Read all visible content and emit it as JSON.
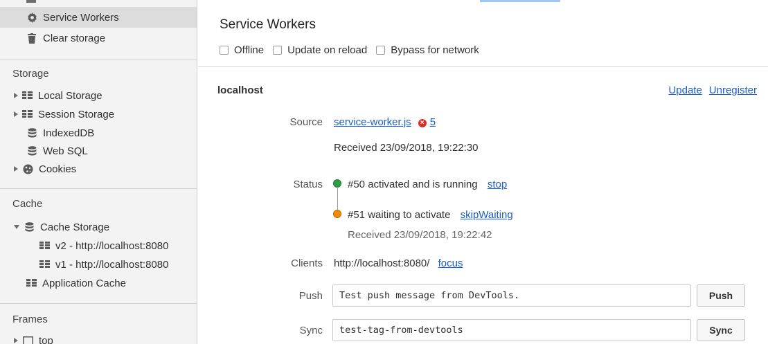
{
  "sidebar": {
    "app_items": [
      {
        "label": "Service Workers",
        "icon": "gear-icon",
        "selected": true
      },
      {
        "label": "Clear storage",
        "icon": "trash-icon",
        "selected": false
      }
    ],
    "storage": {
      "header": "Storage",
      "items": [
        {
          "label": "Local Storage",
          "icon": "table-icon",
          "expandable": true
        },
        {
          "label": "Session Storage",
          "icon": "table-icon",
          "expandable": true
        },
        {
          "label": "IndexedDB",
          "icon": "database-icon",
          "expandable": false
        },
        {
          "label": "Web SQL",
          "icon": "database-icon",
          "expandable": false
        },
        {
          "label": "Cookies",
          "icon": "cookie-icon",
          "expandable": true
        }
      ]
    },
    "cache": {
      "header": "Cache",
      "items": [
        {
          "label": "Cache Storage",
          "icon": "database-icon",
          "expanded": true
        },
        {
          "label": "v2 - http://localhost:8080",
          "icon": "table-icon"
        },
        {
          "label": "v1 - http://localhost:8080",
          "icon": "table-icon"
        },
        {
          "label": "Application Cache",
          "icon": "table-icon"
        }
      ]
    },
    "frames": {
      "header": "Frames",
      "items": [
        {
          "label": "top",
          "icon": "frame-icon",
          "expandable": true
        }
      ]
    }
  },
  "main": {
    "title": "Service Workers",
    "options": [
      {
        "label": "Offline",
        "checked": false
      },
      {
        "label": "Update on reload",
        "checked": false
      },
      {
        "label": "Bypass for network",
        "checked": false
      }
    ],
    "worker": {
      "host": "localhost",
      "update_link": "Update",
      "unregister_link": "Unregister",
      "source_label": "Source",
      "source_file": "service-worker.js",
      "error_count": "5",
      "source_received": "Received 23/09/2018, 19:22:30",
      "status_label": "Status",
      "status_active": "#50 activated and is running",
      "stop_link": "stop",
      "status_waiting": "#51 waiting to activate",
      "skip_link": "skipWaiting",
      "waiting_received": "Received 23/09/2018, 19:22:42",
      "clients_label": "Clients",
      "client_url": "http://localhost:8080/",
      "focus_link": "focus",
      "push_label": "Push",
      "push_value": "Test push message from DevTools.",
      "push_button": "Push",
      "sync_label": "Sync",
      "sync_value": "test-tag-from-devtools",
      "sync_button": "Sync"
    }
  },
  "colors": {
    "link": "#1a5ec7",
    "active_status": "#2f9e44",
    "waiting_status": "#f08c00",
    "error": "#d93025",
    "selected_row": "#dcdcdc"
  }
}
